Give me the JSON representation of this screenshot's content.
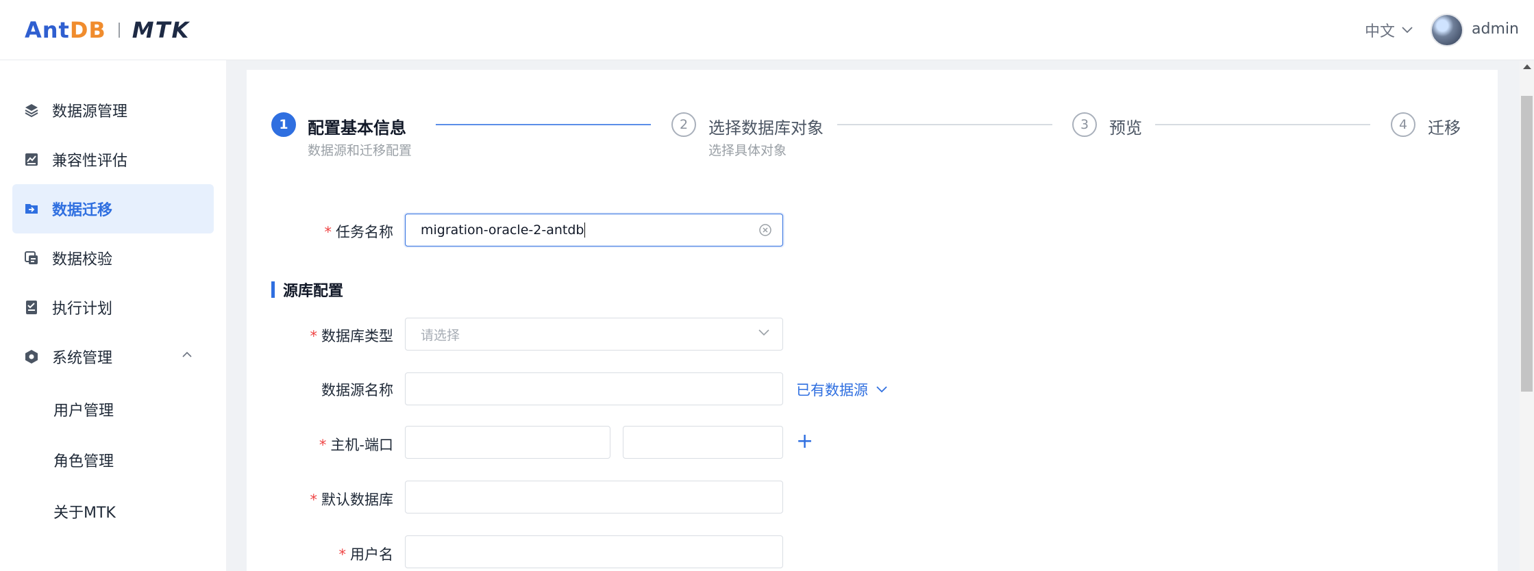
{
  "header": {
    "logo_antdb": "AntDB",
    "logo_mtk": "MTK",
    "language": "中文",
    "username": "admin"
  },
  "sidebar": {
    "items": [
      {
        "label": "数据源管理",
        "icon": "layers-icon"
      },
      {
        "label": "兼容性评估",
        "icon": "chart-icon"
      },
      {
        "label": "数据迁移",
        "icon": "folder-icon",
        "active": true
      },
      {
        "label": "数据校验",
        "icon": "copy-icon"
      },
      {
        "label": "执行计划",
        "icon": "checklist-icon"
      },
      {
        "label": "系统管理",
        "icon": "gear-icon",
        "expanded": true
      }
    ],
    "sub_items": [
      {
        "label": "用户管理"
      },
      {
        "label": "角色管理"
      },
      {
        "label": "关于MTK"
      }
    ]
  },
  "steps": [
    {
      "number": "1",
      "title": "配置基本信息",
      "desc": "数据源和迁移配置",
      "active": true
    },
    {
      "number": "2",
      "title": "选择数据库对象",
      "desc": "选择具体对象"
    },
    {
      "number": "3",
      "title": "预览",
      "desc": ""
    },
    {
      "number": "4",
      "title": "迁移",
      "desc": ""
    }
  ],
  "form": {
    "task_name": {
      "label": "任务名称",
      "value": "migration-oracle-2-antdb"
    },
    "section_title": "源库配置",
    "db_type": {
      "label": "数据库类型",
      "placeholder": "请选择"
    },
    "datasource_name": {
      "label": "数据源名称",
      "value": ""
    },
    "existing_datasource": "已有数据源",
    "host_port": {
      "label": "主机-端口",
      "host": "",
      "port": "",
      "add": "+"
    },
    "default_db": {
      "label": "默认数据库",
      "value": ""
    },
    "username": {
      "label": "用户名",
      "value": ""
    }
  },
  "colors": {
    "accent": "#2f6fe0",
    "required": "#ef4444",
    "active_bg": "#e7f0fd"
  }
}
